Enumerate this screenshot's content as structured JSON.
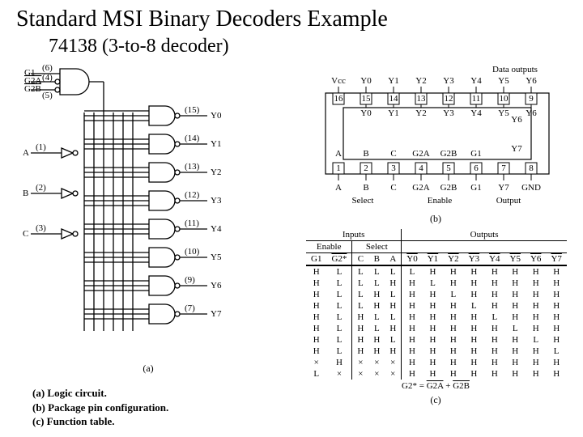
{
  "title": "Standard MSI Binary Decoders Example",
  "subtitle": "74138  (3-to-8 decoder)",
  "captions": {
    "a": "(a) Logic circuit.",
    "b": "(b) Package pin configuration.",
    "c": "(c)  Function table."
  },
  "panel_a": {
    "enable_inputs": [
      "G1",
      "G2A",
      "G2B"
    ],
    "enable_pins": [
      "(6)",
      "(4)",
      "(5)"
    ],
    "select_inputs": [
      "A",
      "B",
      "C"
    ],
    "select_pins": [
      "(1)",
      "(2)",
      "(3)"
    ],
    "outputs": [
      "Y0",
      "Y1",
      "Y2",
      "Y3",
      "Y4",
      "Y5",
      "Y6",
      "Y7"
    ],
    "output_pins": [
      "(15)",
      "(14)",
      "(13)",
      "(12)",
      "(11)",
      "(10)",
      "(9)",
      "(7)"
    ],
    "label": "(a)"
  },
  "panel_b": {
    "header": "Data outputs",
    "top_labels": [
      "Vcc",
      "Y0",
      "Y1",
      "Y2",
      "Y3",
      "Y4",
      "Y5",
      "Y6"
    ],
    "top_pins": [
      "16",
      "15",
      "14",
      "13",
      "12",
      "11",
      "10",
      "9"
    ],
    "bottom_labels": [
      "A",
      "B",
      "C",
      "G2A",
      "G2B",
      "G1",
      "Y7",
      "GND"
    ],
    "bottom_pins": [
      "1",
      "2",
      "3",
      "4",
      "5",
      "6",
      "7",
      "8"
    ],
    "inside_outputs": [
      "Y0",
      "Y1",
      "Y2",
      "Y3",
      "Y4",
      "Y5",
      "Y6",
      "Y7"
    ],
    "inside_select": [
      "A",
      "B",
      "C"
    ],
    "inside_enable": [
      "G2A",
      "G2B",
      "G1"
    ],
    "groups": {
      "select": "Select",
      "enable": "Enable",
      "output": "Output"
    },
    "label": "(b)"
  },
  "panel_c": {
    "section_inputs": "Inputs",
    "section_outputs": "Outputs",
    "sub_enable": "Enable",
    "sub_select": "Select",
    "cols_enable": [
      "G1",
      "G2*"
    ],
    "cols_select": [
      "C",
      "B",
      "A"
    ],
    "cols_out": [
      "Y0",
      "Y1",
      "Y2",
      "Y3",
      "Y4",
      "Y5",
      "Y6",
      "Y7"
    ],
    "rows": [
      [
        "H",
        "L",
        "L",
        "L",
        "L",
        "L",
        "H",
        "H",
        "H",
        "H",
        "H",
        "H",
        "H"
      ],
      [
        "H",
        "L",
        "L",
        "L",
        "H",
        "H",
        "L",
        "H",
        "H",
        "H",
        "H",
        "H",
        "H"
      ],
      [
        "H",
        "L",
        "L",
        "H",
        "L",
        "H",
        "H",
        "L",
        "H",
        "H",
        "H",
        "H",
        "H"
      ],
      [
        "H",
        "L",
        "L",
        "H",
        "H",
        "H",
        "H",
        "H",
        "L",
        "H",
        "H",
        "H",
        "H"
      ],
      [
        "H",
        "L",
        "H",
        "L",
        "L",
        "H",
        "H",
        "H",
        "H",
        "L",
        "H",
        "H",
        "H"
      ],
      [
        "H",
        "L",
        "H",
        "L",
        "H",
        "H",
        "H",
        "H",
        "H",
        "H",
        "L",
        "H",
        "H"
      ],
      [
        "H",
        "L",
        "H",
        "H",
        "L",
        "H",
        "H",
        "H",
        "H",
        "H",
        "H",
        "L",
        "H"
      ],
      [
        "H",
        "L",
        "H",
        "H",
        "H",
        "H",
        "H",
        "H",
        "H",
        "H",
        "H",
        "H",
        "L"
      ],
      [
        "×",
        "H",
        "×",
        "×",
        "×",
        "H",
        "H",
        "H",
        "H",
        "H",
        "H",
        "H",
        "H"
      ],
      [
        "L",
        "×",
        "×",
        "×",
        "×",
        "H",
        "H",
        "H",
        "H",
        "H",
        "H",
        "H",
        "H"
      ]
    ],
    "note_prefix": "G2* = ",
    "note_a": "G2A",
    "note_plus": " + ",
    "note_b": "G2B",
    "label": "(c)"
  }
}
